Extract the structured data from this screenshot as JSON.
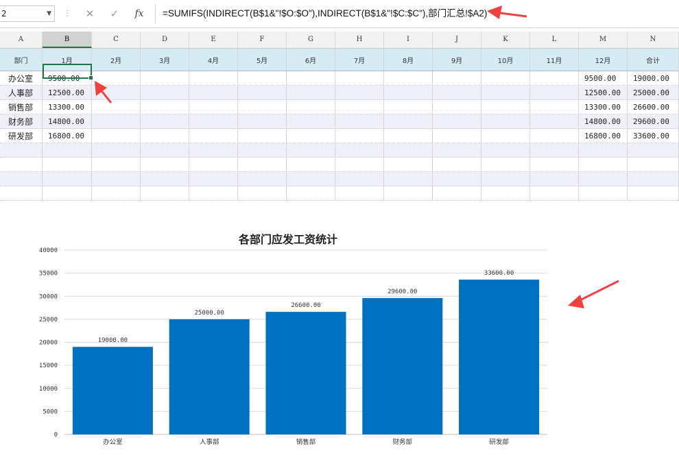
{
  "formula_bar": {
    "name_box": "2",
    "name_box_dropdown": "▼",
    "separator": "⋮",
    "cancel_glyph": "✕",
    "enter_glyph": "✓",
    "fx_glyph": "fx",
    "formula": "=SUMIFS(INDIRECT(B$1&\"!$O:$O\"),INDIRECT(B$1&\"!$C:$C\"),部门汇总!$A2)"
  },
  "sheet": {
    "column_letters": [
      "A",
      "B",
      "C",
      "D",
      "E",
      "F",
      "G",
      "H",
      "I",
      "J",
      "K",
      "L",
      "M",
      "N"
    ],
    "selected_column": "B",
    "header_row": [
      "部门",
      "1月",
      "2月",
      "3月",
      "4月",
      "5月",
      "6月",
      "7月",
      "8月",
      "9月",
      "10月",
      "11月",
      "12月",
      "合计"
    ],
    "rows": [
      {
        "dept": "办公室",
        "jan": "9500.00",
        "dec": "9500.00",
        "total": "19000.00"
      },
      {
        "dept": "人事部",
        "jan": "12500.00",
        "dec": "12500.00",
        "total": "25000.00"
      },
      {
        "dept": "销售部",
        "jan": "13300.00",
        "dec": "13300.00",
        "total": "26600.00"
      },
      {
        "dept": "财务部",
        "jan": "14800.00",
        "dec": "14800.00",
        "total": "29600.00"
      },
      {
        "dept": "研发部",
        "jan": "16800.00",
        "dec": "16800.00",
        "total": "33600.00"
      }
    ],
    "active_cell": "B2"
  },
  "colors": {
    "bar": "#0070c0",
    "header_fill": "#d6ebf4",
    "alt_row": "#f0f0fb",
    "selection": "#217346",
    "arrow": "#f04040"
  },
  "chart_data": {
    "type": "bar",
    "title": "各部门应发工资统计",
    "categories": [
      "办公室",
      "人事部",
      "销售部",
      "财务部",
      "研发部"
    ],
    "values": [
      19000,
      25000,
      26600,
      29600,
      33600
    ],
    "data_labels": [
      "19000.00",
      "25000.00",
      "26600.00",
      "29600.00",
      "33600.00"
    ],
    "ylim": [
      0,
      40000
    ],
    "yticks": [
      0,
      5000,
      10000,
      15000,
      20000,
      25000,
      30000,
      35000,
      40000
    ],
    "grid": true,
    "xlabel": "",
    "ylabel": ""
  }
}
